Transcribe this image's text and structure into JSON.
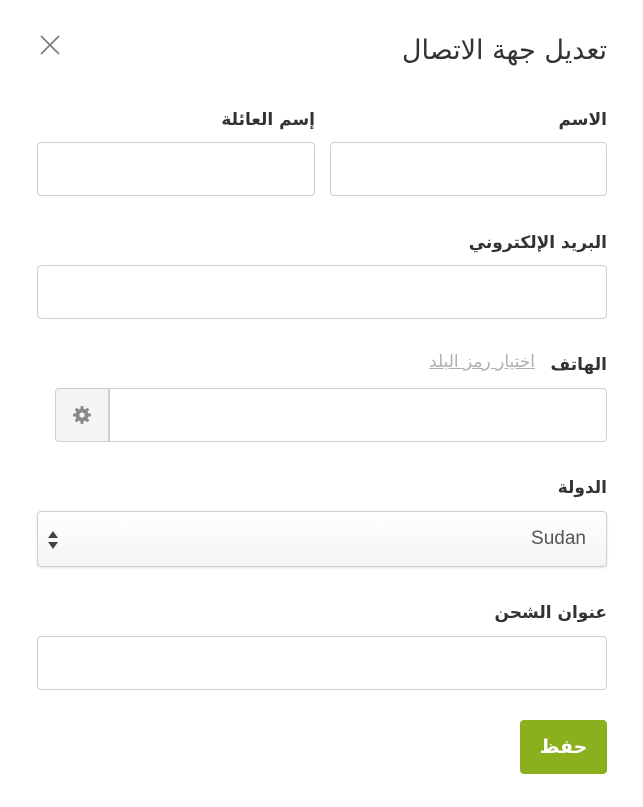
{
  "dialog": {
    "title": "تعديل جهة الاتصال",
    "close_icon": "close-icon"
  },
  "form": {
    "first_name": {
      "label": "الاسم",
      "value": ""
    },
    "last_name": {
      "label": "إسم العائلة",
      "value": ""
    },
    "email": {
      "label": "البريد الإلكتروني",
      "value": ""
    },
    "phone": {
      "label": "الهاتف",
      "value": "",
      "country_code_link": "اختيار رمز البلد",
      "settings_icon": "gear-icon"
    },
    "country": {
      "label": "الدولة",
      "selected": "Sudan",
      "arrows_icon": "select-arrows-icon"
    },
    "shipping_address": {
      "label": "عنوان الشحن",
      "value": ""
    }
  },
  "actions": {
    "save_label": "حفظ"
  },
  "colors": {
    "save_button": "#8ab01e",
    "border": "#cfcfcf"
  }
}
